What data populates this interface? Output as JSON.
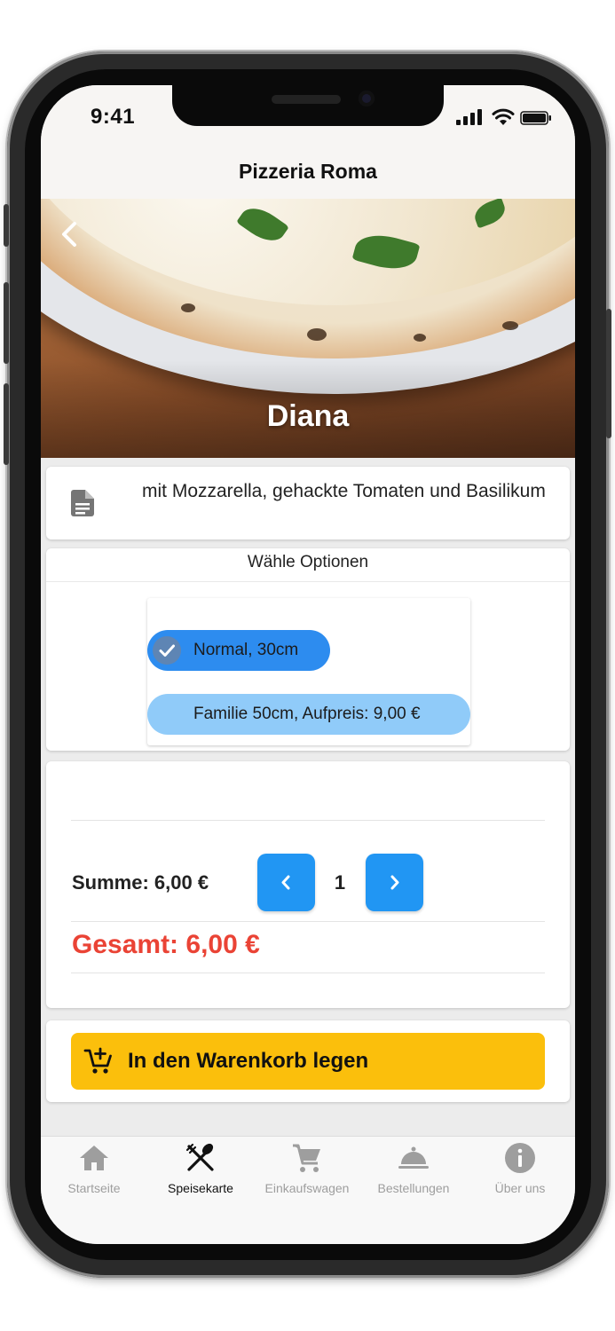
{
  "status_bar": {
    "time": "9:41"
  },
  "nav": {
    "title": "Pizzeria Roma"
  },
  "hero": {
    "title": "Diana"
  },
  "description": {
    "text": "mit Mozzarella, gehackte Tomaten und Basilikum"
  },
  "options": {
    "header": "Wähle Optionen",
    "items": [
      {
        "label": "Normal, 30cm",
        "selected": true
      },
      {
        "label": "Familie 50cm, Aufpreis: 9,00 €",
        "selected": false
      }
    ]
  },
  "summary": {
    "sum_label": "Summe: 6,00 €",
    "quantity": "1",
    "total_label": "Gesamt: 6,00 €"
  },
  "cart": {
    "button_label": "In den Warenkorb legen"
  },
  "tabs": [
    {
      "label": "Startseite",
      "icon": "home-icon",
      "active": false
    },
    {
      "label": "Speisekarte",
      "icon": "utensils-icon",
      "active": true
    },
    {
      "label": "Einkaufswagen",
      "icon": "cart-icon",
      "active": false
    },
    {
      "label": "Bestellungen",
      "icon": "cloche-icon",
      "active": false
    },
    {
      "label": "Über uns",
      "icon": "info-icon",
      "active": false
    }
  ],
  "colors": {
    "primary_blue": "#2196f3",
    "selected_chip": "#2d8cef",
    "unselected_chip": "#90cbf9",
    "total_red": "#ea4335",
    "cart_yellow": "#fbbf0c"
  }
}
